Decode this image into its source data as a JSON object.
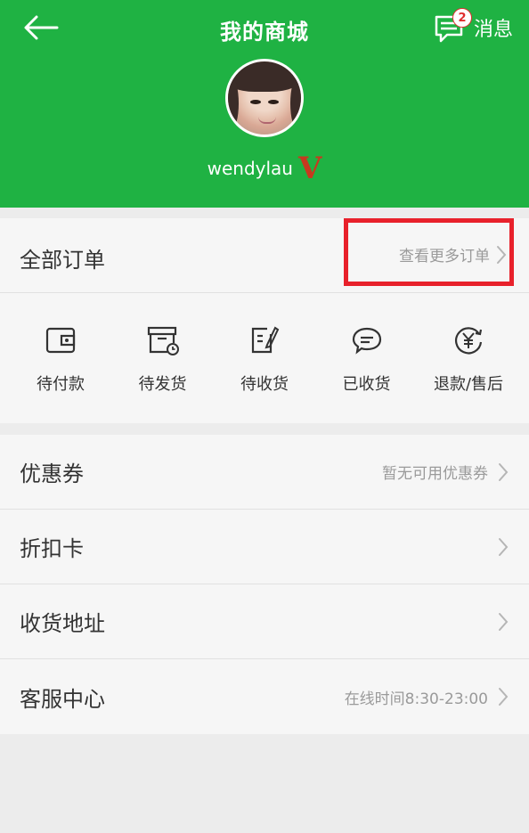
{
  "header": {
    "title": "我的商城",
    "message_label": "消息",
    "message_badge": "2",
    "back_icon": "back-arrow-icon",
    "message_icon": "message-icon"
  },
  "user": {
    "name": "wendylau",
    "vip_mark": "V"
  },
  "orders": {
    "title": "全部订单",
    "more_label": "查看更多订单",
    "items": [
      {
        "label": "待付款",
        "icon": "wallet-icon"
      },
      {
        "label": "待发货",
        "icon": "box-clock-icon"
      },
      {
        "label": "待收货",
        "icon": "edit-note-icon"
      },
      {
        "label": "已收货",
        "icon": "chat-bubble-icon"
      },
      {
        "label": "退款/售后",
        "icon": "refund-yen-icon"
      }
    ]
  },
  "list": {
    "items": [
      {
        "label": "优惠券",
        "right": "暂无可用优惠券"
      },
      {
        "label": "折扣卡",
        "right": ""
      },
      {
        "label": "收货地址",
        "right": ""
      },
      {
        "label": "客服中心",
        "right": "在线时间8:30-23:00"
      }
    ]
  },
  "colors": {
    "brand_green": "#1fb243",
    "highlight_red": "#e8212b",
    "vip_red": "#c7391f",
    "text_dark": "#333333",
    "text_gray": "#9a9a9a"
  }
}
